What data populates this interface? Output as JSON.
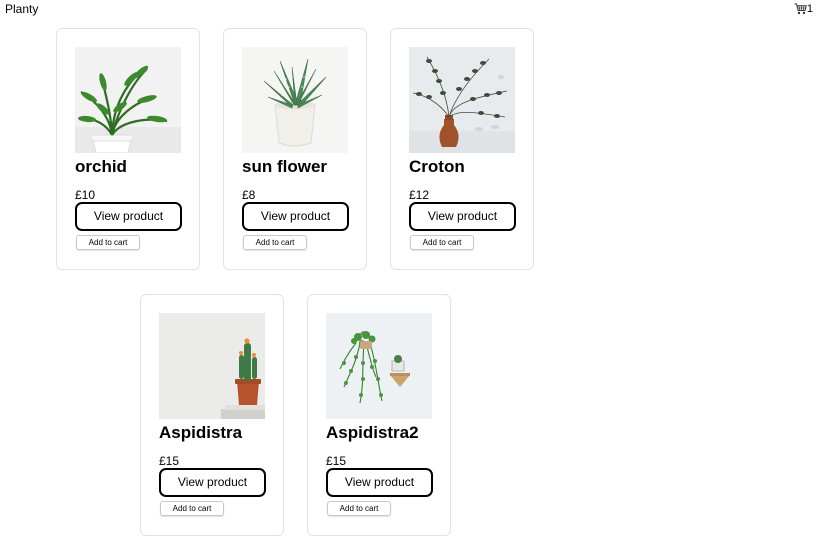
{
  "header": {
    "brand": "Planty",
    "cart_icon": "shopping-cart-icon",
    "cart_count": "1"
  },
  "products": [
    {
      "name": "orchid",
      "price": "£10",
      "view_label": "View product",
      "add_label": "Add to cart",
      "image": "potted-palm-plant"
    },
    {
      "name": "sun flower",
      "price": "£8",
      "view_label": "View product",
      "add_label": "Add to cart",
      "image": "aloe-succulent-in-white-pot"
    },
    {
      "name": "Croton",
      "price": "£12",
      "view_label": "View product",
      "add_label": "Add to cart",
      "image": "eucalyptus-branch-in-terracotta-vase"
    },
    {
      "name": "Aspidistra",
      "price": "£15",
      "view_label": "View product",
      "add_label": "Add to cart",
      "image": "cactus-in-terracotta-pot"
    },
    {
      "name": "Aspidistra2",
      "price": "£15",
      "view_label": "View product",
      "add_label": "Add to cart",
      "image": "hanging-trailing-plant"
    }
  ]
}
